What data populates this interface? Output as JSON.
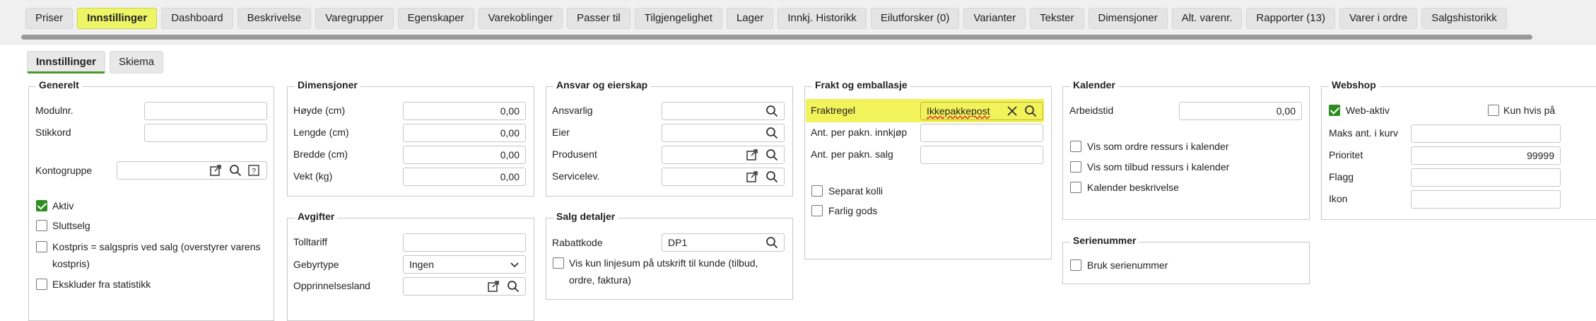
{
  "tabs": [
    {
      "label": "Priser"
    },
    {
      "label": "Innstillinger"
    },
    {
      "label": "Dashboard"
    },
    {
      "label": "Beskrivelse"
    },
    {
      "label": "Varegrupper"
    },
    {
      "label": "Egenskaper"
    },
    {
      "label": "Varekoblinger"
    },
    {
      "label": "Passer til"
    },
    {
      "label": "Tilgjengelighet"
    },
    {
      "label": "Lager"
    },
    {
      "label": "Innkj. Historikk"
    },
    {
      "label": "Eilutforsker (0)"
    },
    {
      "label": "Varianter"
    },
    {
      "label": "Tekster"
    },
    {
      "label": "Dimensjoner"
    },
    {
      "label": "Alt. varenr."
    },
    {
      "label": "Rapporter (13)"
    },
    {
      "label": "Varer i ordre"
    },
    {
      "label": "Salgshistorikk"
    }
  ],
  "subtabs": [
    {
      "label": "Innstillinger"
    },
    {
      "label": "Skiema"
    }
  ],
  "generelt": {
    "title": "Generelt",
    "modulnr": "Modulnr.",
    "stikkord": "Stikkord",
    "kontogruppe": "Kontogruppe",
    "aktiv": "Aktiv",
    "sluttselg": "Sluttselg",
    "kostpris": "Kostpris = salgspris ved salg (overstyrer varens",
    "kostpris2": "kostpris)",
    "ekskluder": "Ekskluder fra statistikk"
  },
  "dimensjoner": {
    "title": "Dimensjoner",
    "rows": [
      {
        "label": "Høyde (cm)",
        "value": "0,00"
      },
      {
        "label": "Lengde (cm)",
        "value": "0,00"
      },
      {
        "label": "Bredde (cm)",
        "value": "0,00"
      },
      {
        "label": "Vekt (kg)",
        "value": "0,00"
      }
    ]
  },
  "avgifter": {
    "title": "Avgifter",
    "tolltariff": "Tolltariff",
    "gebyrtype": "Gebyrtype",
    "gebyrtype_value": "Ingen",
    "opprinnelsesland": "Opprinnelsesland"
  },
  "ansvar": {
    "title": "Ansvar og eierskap",
    "ansvarlig": "Ansvarlig",
    "eier": "Eier",
    "produsent": "Produsent",
    "servicelev": "Servicelev."
  },
  "salg": {
    "title": "Salg detaljer",
    "rabattkode": "Rabattkode",
    "rabattkode_value": "DP1",
    "vis_kun": "Vis kun linjesum på utskrift til kunde (tilbud,",
    "vis_kun2": "ordre, faktura)"
  },
  "frakt": {
    "title": "Frakt og emballasje",
    "fraktregel": "Fraktregel",
    "fraktregel_value": "Ikkepakkepost",
    "innkjop": "Ant. per pakn. innkjøp",
    "salg": "Ant. per pakn. salg",
    "separat": "Separat kolli",
    "farlig": "Farlig gods"
  },
  "kalender": {
    "title": "Kalender",
    "arbeidstid": "Arbeidstid",
    "arbeidstid_value": "0,00",
    "ordre": "Vis som ordre ressurs i kalender",
    "tilbud": "Vis som tilbud ressurs i kalender",
    "beskrivelse": "Kalender beskrivelse"
  },
  "serienummer": {
    "title": "Serienummer",
    "bruk": "Bruk serienummer"
  },
  "webshop": {
    "title": "Webshop",
    "web_aktiv": "Web-aktiv",
    "kun_hvis": "Kun hvis på",
    "maks": "Maks ant. i kurv",
    "prioritet": "Prioritet",
    "prioritet_value": "99999",
    "flagg": "Flagg",
    "ikon": "Ikon"
  },
  "colors": {
    "highlight": "#f2f25a",
    "accent_green": "#2e8b1d"
  }
}
